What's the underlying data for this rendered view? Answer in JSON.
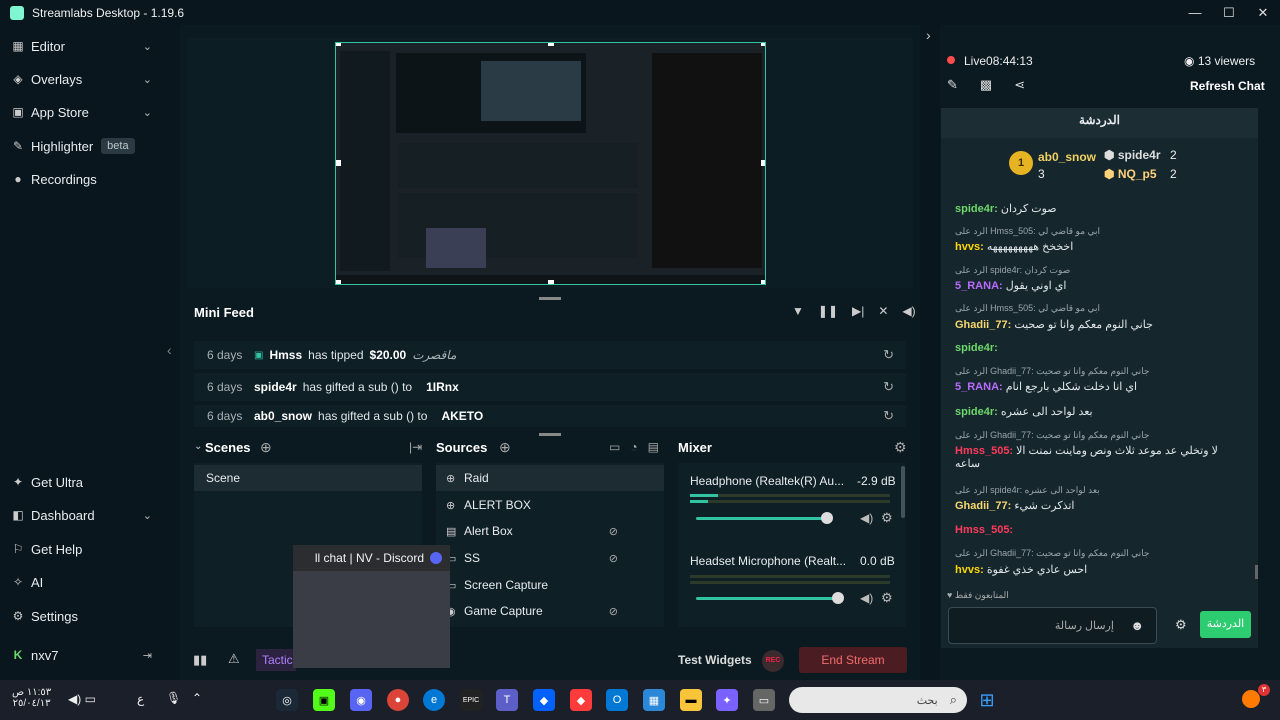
{
  "window": {
    "title": "Streamlabs Desktop - 1.19.6",
    "controls": [
      "—",
      "☐",
      "✕"
    ]
  },
  "sidebar": {
    "items": [
      {
        "label": "Editor",
        "chevron": "⌄"
      },
      {
        "label": "Overlays",
        "chevron": "⌄"
      },
      {
        "label": "App Store",
        "chevron": "⌄"
      },
      {
        "label": "Highlighter",
        "badge": "beta"
      },
      {
        "label": "Recordings"
      }
    ],
    "bottom_items": [
      {
        "label": "Get Ultra"
      },
      {
        "label": "Dashboard",
        "chevron": "⌄"
      },
      {
        "label": "Get Help"
      },
      {
        "label": "AI"
      },
      {
        "label": "Settings"
      }
    ],
    "user": {
      "name": "nxv7"
    }
  },
  "mini_feed": {
    "title": "Mini Feed",
    "rows": [
      {
        "ago": "6 days",
        "user": "Hmss",
        "action": "has tipped",
        "amount": "$20.00",
        "message": "ماقصرت"
      },
      {
        "ago": "6 days",
        "user": "spide4r",
        "action": "has gifted a sub () to",
        "amount": "1IRnx",
        "message": ""
      },
      {
        "ago": "6 days",
        "user": "ab0_snow",
        "action": "has gifted a sub () to",
        "amount": "AKETO",
        "message": ""
      }
    ]
  },
  "scenes": {
    "title": "Scenes",
    "items": [
      "Scene"
    ]
  },
  "sources": {
    "title": "Sources",
    "items": [
      "Raid",
      "ALERT BOX",
      "Alert Box",
      "SS",
      "Screen Capture",
      "Game Capture"
    ]
  },
  "mixer": {
    "title": "Mixer",
    "channels": [
      {
        "name": "Headphone (Realtek(R) Au...",
        "db": "-2.9 dB",
        "level": 0.88
      },
      {
        "name": "Headset Microphone (Realt...",
        "db": "0.0 dB",
        "level": 1.0
      }
    ]
  },
  "bottombar": {
    "tactic": "Tactic",
    "test_widgets": "Test Widgets",
    "rec": "REC",
    "end_stream": "End Stream"
  },
  "discord_popup": {
    "label": "ll chat | NV - Discord"
  },
  "stream": {
    "status": "Live",
    "time": "08:44:13",
    "viewers": "13 viewers",
    "refresh": "Refresh Chat"
  },
  "chat": {
    "header": "الدردشة",
    "leaders": [
      {
        "name": "ab0_snow",
        "count": "3"
      },
      {
        "name": "spide4r",
        "count": "2"
      },
      {
        "name": "NQ_p5",
        "count": "2"
      }
    ],
    "messages": [
      {
        "reply": "",
        "user": "spide4r:",
        "text": "صوت كردان",
        "color": "#6dd86a"
      },
      {
        "reply": "الرد على Hmss_505: ابي مو قاضي لي",
        "user": "hvvs:",
        "text": "اخخخخ هههههههههه",
        "color": "#ffd700"
      },
      {
        "reply": "الرد على spide4r: صوت كردان",
        "user": "5_RANA:",
        "text": "اي اوني يقول",
        "color": "#b96bff"
      },
      {
        "reply": "الرد على Hmss_505: ابي مو قاضي لي",
        "user": "Ghadii_77:",
        "text": "جاني النوم معكم وانا تو صحيت",
        "color": "#f5d76e"
      },
      {
        "reply": "",
        "user": "spide4r:",
        "text": "",
        "color": "#6dd86a"
      },
      {
        "reply": "الرد على Ghadii_77: جاني النوم معكم وانا تو صحيت",
        "user": "5_RANA:",
        "text": "اي انا دخلت شكلي بارجع انام",
        "color": "#b96bff"
      },
      {
        "reply": "",
        "user": "spide4r:",
        "text": "بعد لواحد الى عشره",
        "color": "#6dd86a"
      },
      {
        "reply": "الرد على Ghadii_77: جاني النوم معكم وانا تو صحيت",
        "user": "Hmss_505:",
        "text": "لا وتخلي عد موعد ثلاث ونص وماينت نمنت الا ساعه",
        "color": "#ff3b5c"
      },
      {
        "reply": "الرد على spide4r: بعد لواحد الى عشره",
        "user": "Ghadii_77:",
        "text": "اتذكرت شيء",
        "color": "#f5d76e"
      },
      {
        "reply": "",
        "user": "Hmss_505:",
        "text": "",
        "color": "#ff3b5c"
      },
      {
        "reply": "الرد على Ghadii_77: جاني النوم معكم وانا تو صحيت",
        "user": "hvvs:",
        "text": "احس عادي خذي غفوة",
        "color": "#ffd700"
      }
    ],
    "followers_only": "المتابعون فقط",
    "input_placeholder": "إرسال رسالة",
    "send": "الدردشة"
  },
  "taskbar": {
    "clock_time": "١١:٥٣ ص",
    "clock_date": "٢٥/٠٤/١٣",
    "lang": "ع",
    "search_placeholder": "بحث",
    "notif_count": "٣"
  },
  "colors": {
    "accent": "#31c3a2",
    "live": "#ff4d4d",
    "end_stream": "#f46c6c",
    "send_button": "#2ecc71"
  }
}
